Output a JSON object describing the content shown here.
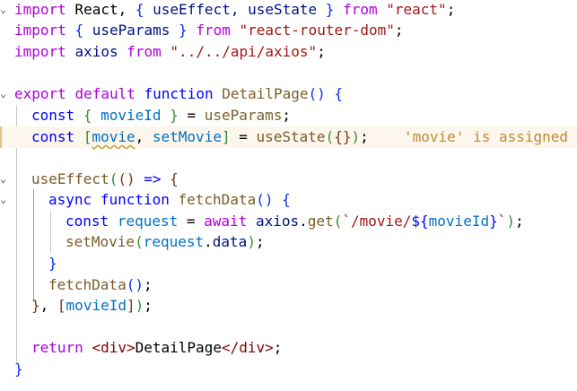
{
  "editor": {
    "line1": {
      "k1": "import",
      "t1": " React, ",
      "b1": "{",
      "t2": " useEffect, useState ",
      "b2": "}",
      "k2": "from",
      "s": "\"react\"",
      "t3": ";"
    },
    "line2": {
      "k1": "import",
      "b1": "{",
      "t1": " useParams ",
      "b2": "}",
      "k2": "from",
      "s": "\"react-router-dom\"",
      "t2": ";"
    },
    "line3": {
      "k1": "import",
      "v": "axios",
      "k2": "from",
      "s": "\"../../api/axios\"",
      "t": ";"
    },
    "line4": {
      "k1": "export",
      "k2": "default",
      "k3": "function",
      "f": "DetailPage",
      "b1": "()",
      "b2": "{"
    },
    "line5": {
      "k": "const",
      "b1": "{",
      "v": "movieId",
      "b2": "}",
      "t": " = ",
      "f": "useParams",
      "t2": ";"
    },
    "line6": {
      "k": "const",
      "b1": "[",
      "v1": "movie",
      "t1": ", ",
      "v2": "setMovie",
      "b2": "]",
      "t2": " = ",
      "f": "useState",
      "b3": "(",
      "b4": "{}",
      "b5": ")",
      "t3": ";",
      "diag": "'movie' is assigned"
    },
    "line7": {
      "f": "useEffect",
      "b1": "(",
      "b2": "()",
      "t": " => ",
      "b3": "{"
    },
    "line8": {
      "k1": "async",
      "k2": "function",
      "f": "fetchData",
      "b1": "()",
      "b2": "{"
    },
    "line9": {
      "k": "const",
      "v": "request",
      "t1": " = ",
      "kc": "await",
      "v2": "axios",
      "t2": ".",
      "f": "get",
      "b1": "(",
      "s1": "`/movie/",
      "b2": "${",
      "v3": "movieId",
      "b3": "}",
      "s2": "`",
      "b4": ")",
      "t3": ";"
    },
    "line10": {
      "f": "setMovie",
      "b1": "(",
      "v": "request",
      "t": ".",
      "v2": "data",
      "b2": ")",
      "t2": ";"
    },
    "line11": {
      "b": "}"
    },
    "line12": {
      "f": "fetchData",
      "b": "()",
      "t": ";"
    },
    "line13": {
      "b1": "}",
      "t": ", ",
      "b2": "[",
      "v": "movieId",
      "b3": "]",
      "b4": ")",
      "t2": ";"
    },
    "line14": {
      "kc": "return",
      "t1": "<",
      "tag1": "div",
      "t2": ">",
      "txt": "DetailPage",
      "t3": "</",
      "tag2": "div",
      "t4": ">",
      "t5": ";"
    },
    "line15": {
      "b": "}"
    }
  },
  "colors": {
    "keyword": "#0000ff",
    "control": "#af00db",
    "string": "#a31515",
    "function": "#795e26",
    "variable": "#001080",
    "warning_bg": "#fdf6ec",
    "diagnostic": "#c08a33"
  }
}
